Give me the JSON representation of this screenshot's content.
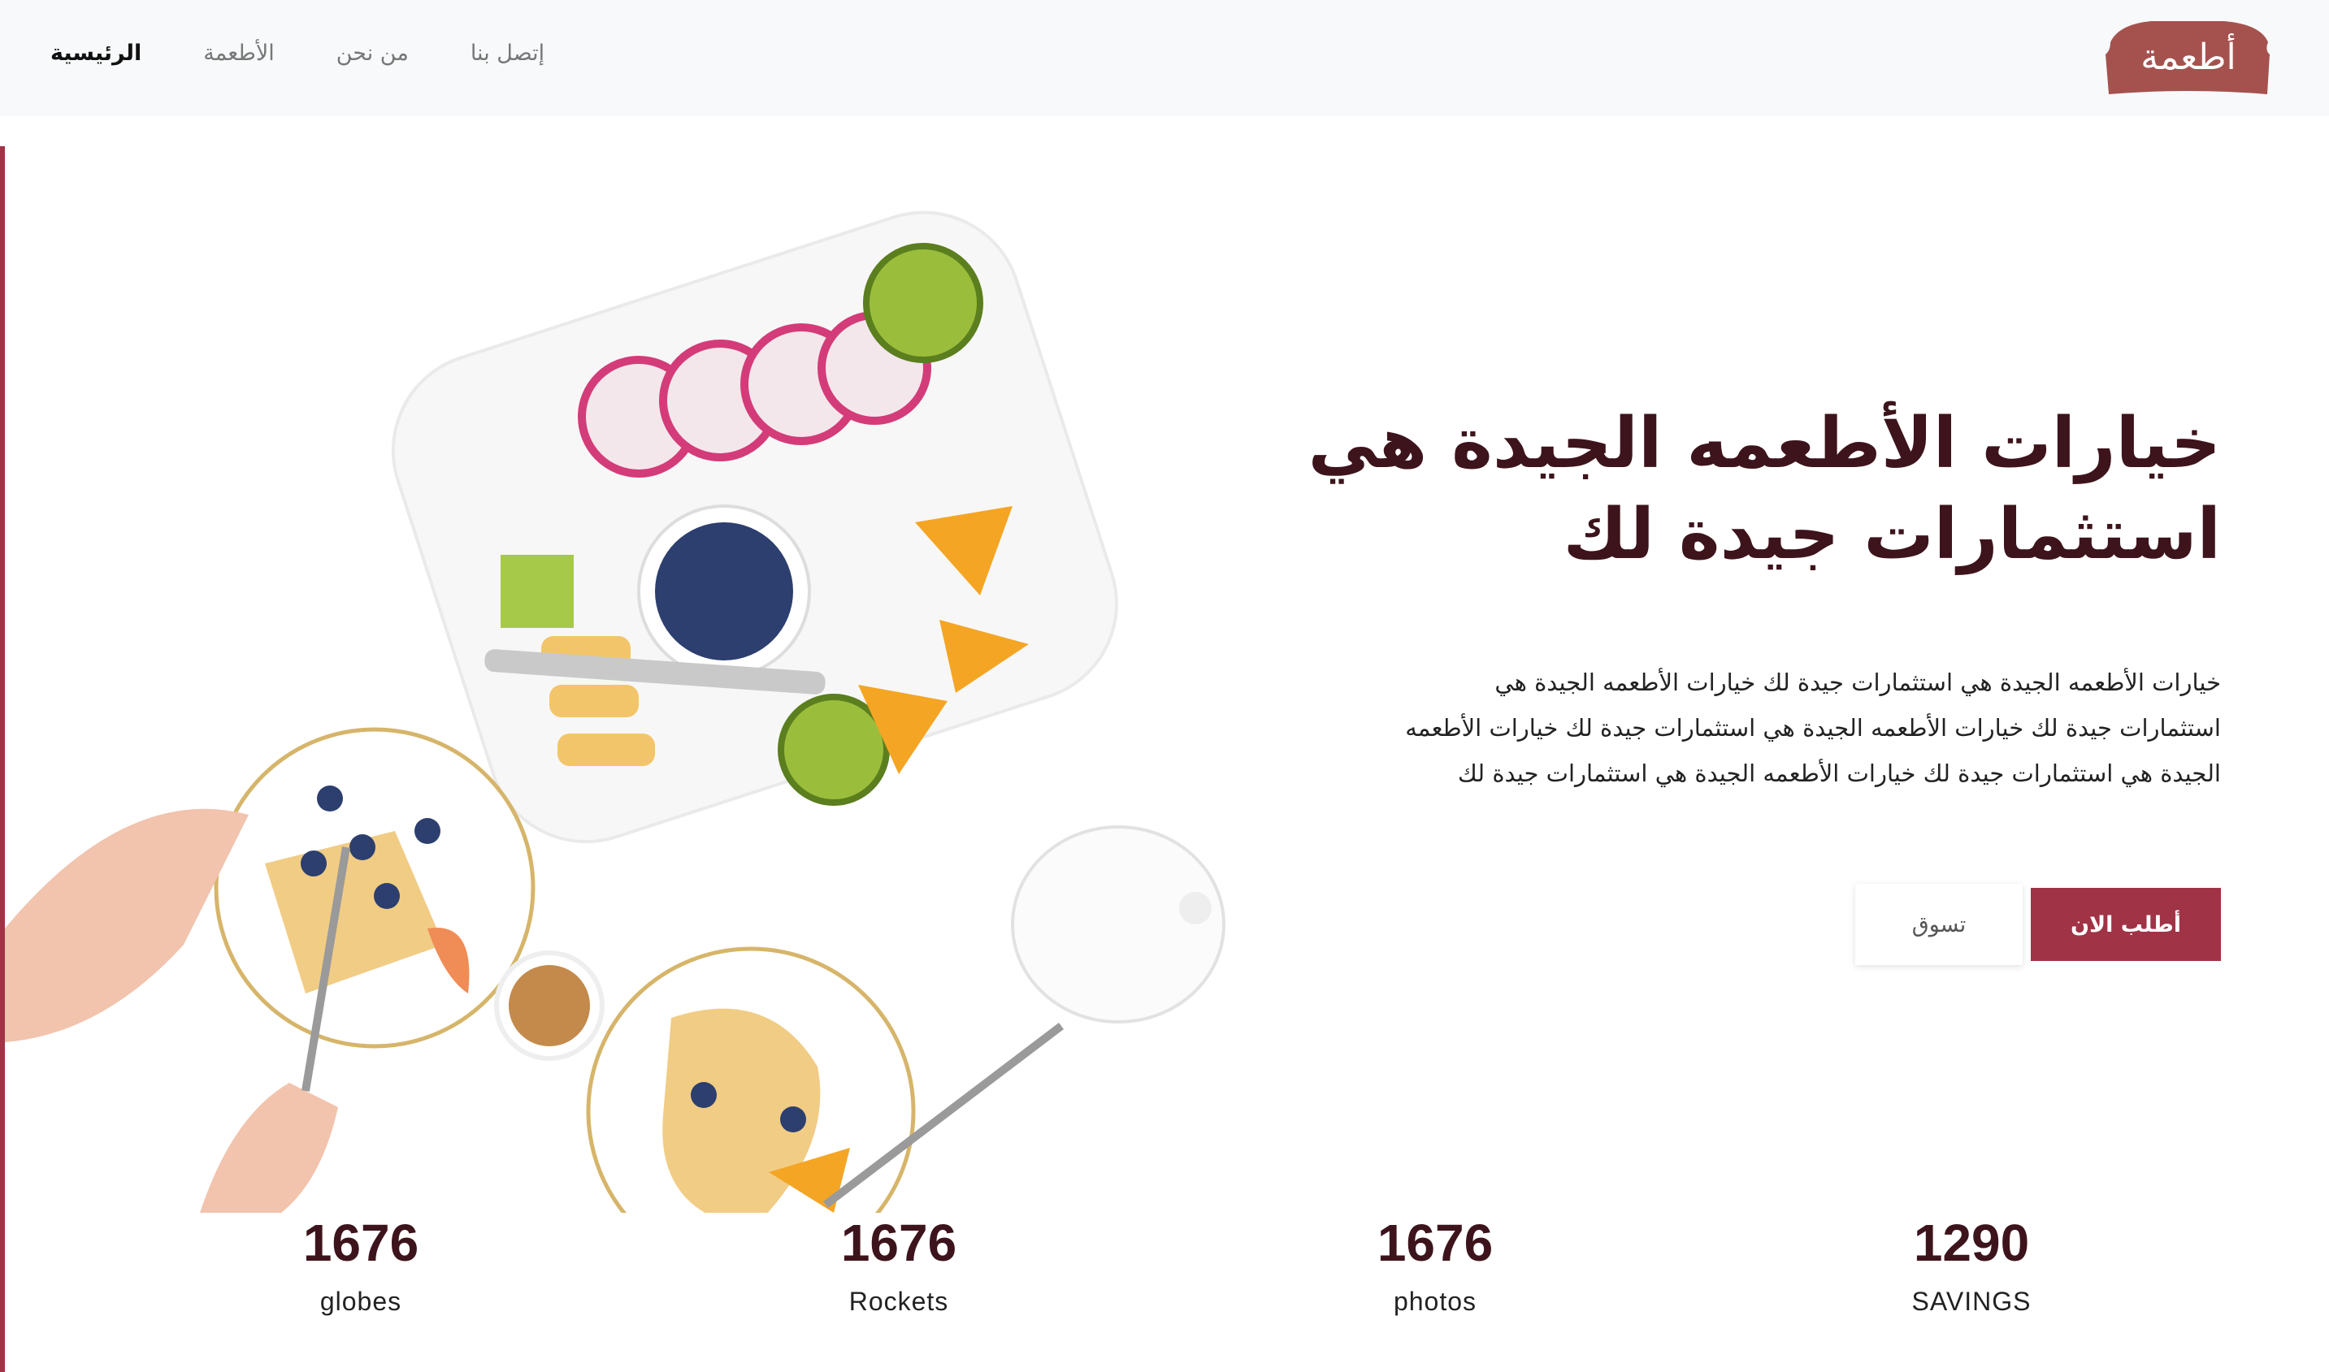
{
  "nav": {
    "logo": "أطعمة",
    "items": [
      {
        "label": "الرئيسية"
      },
      {
        "label": "الأطعمة"
      },
      {
        "label": "من نحن"
      },
      {
        "label": "إتصل بنا"
      }
    ]
  },
  "hero": {
    "title": "خيارات الأطعمه الجيدة هي استثمارات جيدة لك",
    "paragraph": "خيارات الأطعمه الجيدة هي استثمارات جيدة لك خيارات الأطعمه الجيدة هي استثمارات جيدة لك خيارات الأطعمه الجيدة هي استثمارات جيدة لك خيارات الأطعمه الجيدة هي استثمارات جيدة لك خيارات الأطعمه الجيدة هي استثمارات جيدة لك",
    "order_button": "أطلب الان",
    "shop_button": "تسوق"
  },
  "stats": [
    {
      "value": "1676",
      "label": "globes"
    },
    {
      "value": "1676",
      "label": "Rockets"
    },
    {
      "value": "1676",
      "label": "photos"
    },
    {
      "value": "1290",
      "label": "SAVINGS"
    }
  ],
  "colors": {
    "accent": "#a03346",
    "logo": "#a5524f",
    "heading": "#3d141c"
  }
}
